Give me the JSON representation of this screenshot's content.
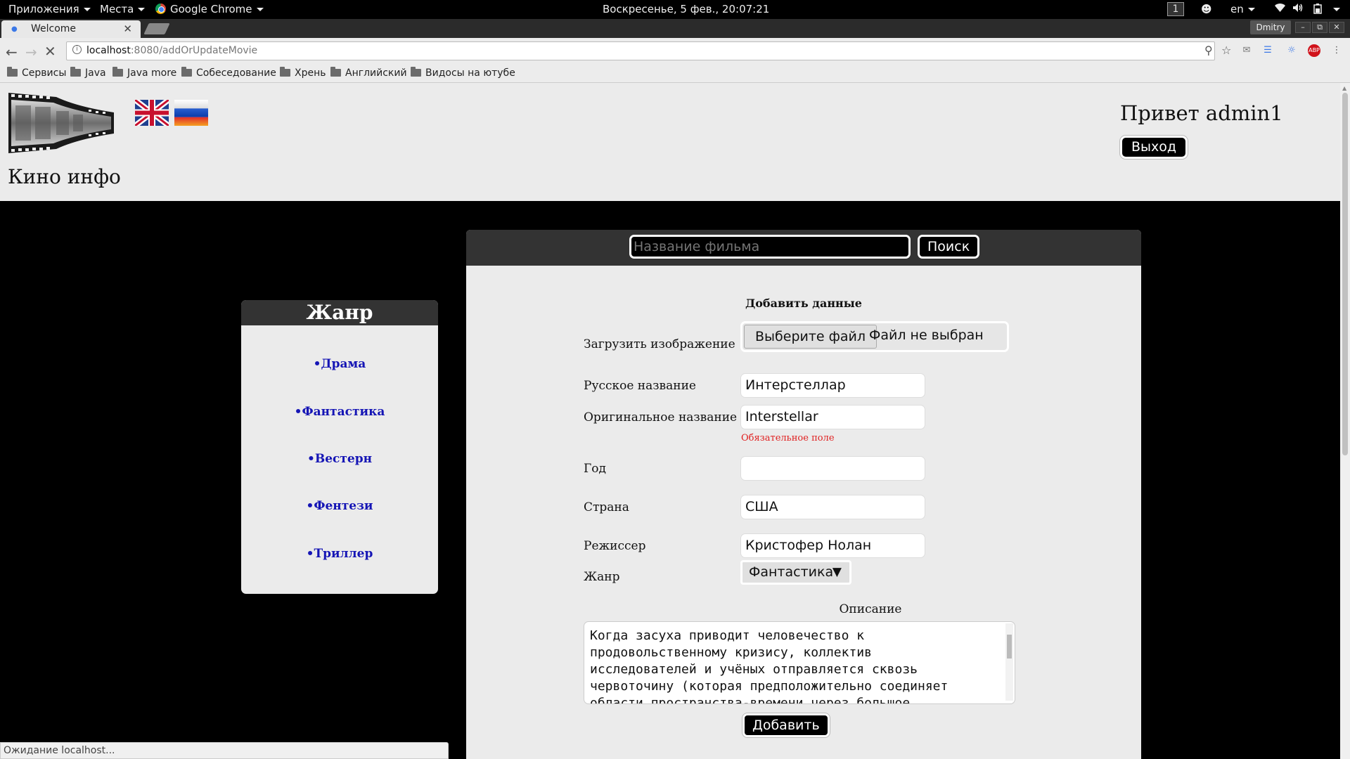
{
  "system_panel": {
    "apps_menu": "Приложения",
    "places_menu": "Места",
    "active_app": "Google Chrome",
    "clock": "Воскресенье,  5 фев., 20:07:21",
    "workspace": "1",
    "keyboard_layout": "en"
  },
  "browser": {
    "tab_title": "Welcome",
    "profile_name": "Dmitry",
    "url_host": "localhost",
    "url_path": ":8080/addOrUpdateMovie",
    "bookmarks": [
      "Сервисы",
      "Java",
      "Java more",
      "Собеседование",
      "Хрень",
      "Английский",
      "Видосы на ютубе"
    ],
    "status_text": "Ожидание localhost..."
  },
  "header": {
    "site_title": "Кино инфо",
    "greeting": "Привет admin1",
    "logout_label": "Выход"
  },
  "search": {
    "placeholder": "Название фильма",
    "button_label": "Поиск"
  },
  "sidebar": {
    "heading": "Жанр",
    "genres": [
      "•Драма",
      "•Фантастика",
      "•Вестерн",
      "•Фентези",
      "•Триллер"
    ]
  },
  "form": {
    "title": "Добавить данные",
    "image_label": "Загрузить изображение",
    "file_button_label": "Выберите файл",
    "file_status": "Файл не выбран",
    "russian_title_label": "Русское название",
    "russian_title_value": "Интерстеллар",
    "original_title_label": "Оригинальное название",
    "original_title_value": "Interstellar",
    "required_error": "Обязательное поле",
    "year_label": "Год",
    "year_value": "",
    "country_label": "Страна",
    "country_value": "США",
    "director_label": "Режиссер",
    "director_value": "Кристофер Нолан",
    "genre_label": "Жанр",
    "genre_selected": "Фантастика",
    "description_label": "Описание",
    "description_text": "Когда засуха приводит человечество к\nпродовольственному кризису, коллектив\nисследователей и учёных отправляется сквозь\nчервоточину (которая предположительно соединяет\nобласти пространства-времени через большое",
    "submit_label": "Добавить"
  }
}
